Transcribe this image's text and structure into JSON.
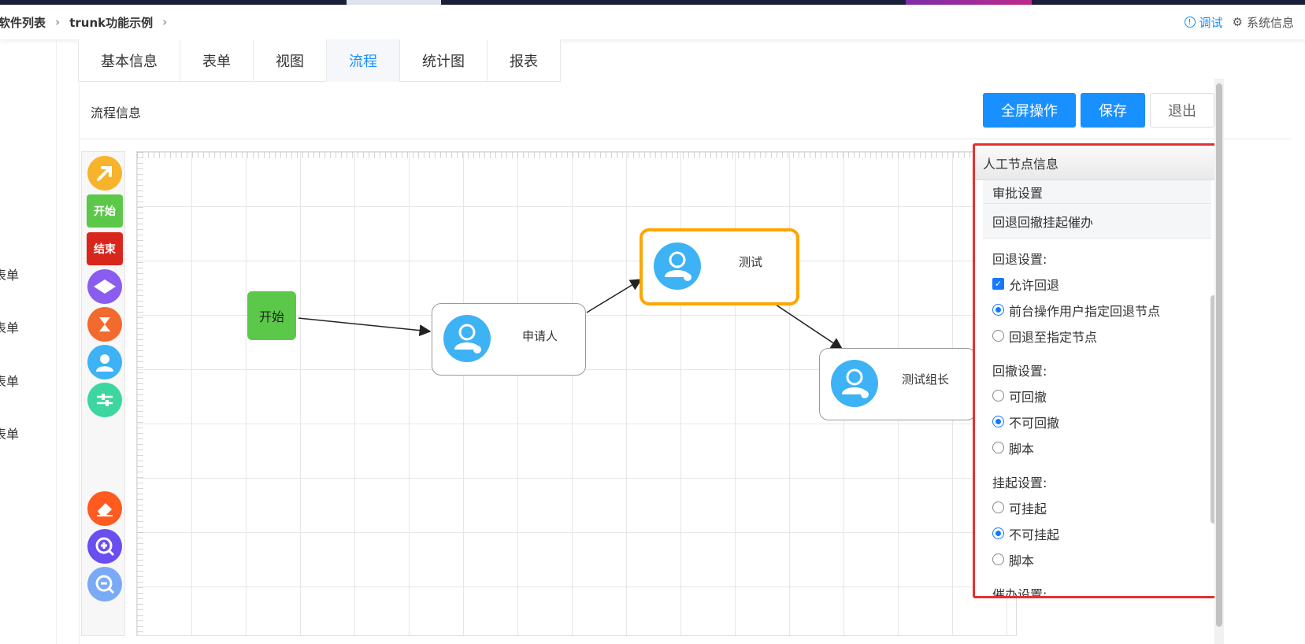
{
  "header": {
    "breadcrumb": [
      "软件列表",
      "trunk功能示例"
    ],
    "debug_label": "调试",
    "system_label": "系统信息"
  },
  "leftnav": {
    "items": [
      "表单",
      "表单",
      "表单",
      "表单"
    ]
  },
  "tabs": [
    {
      "label": "基本信息",
      "active": false
    },
    {
      "label": "表单",
      "active": false
    },
    {
      "label": "视图",
      "active": false
    },
    {
      "label": "流程",
      "active": true
    },
    {
      "label": "统计图",
      "active": false
    },
    {
      "label": "报表",
      "active": false
    }
  ],
  "panel": {
    "title": "流程信息",
    "buttons": {
      "fullscreen": "全屏操作",
      "save": "保存",
      "exit": "退出"
    }
  },
  "toolbar": {
    "tools": [
      {
        "name": "connector-arrow-tool",
        "color": "#f7b32b"
      },
      {
        "name": "start-node-tool",
        "label": "开始",
        "color": "#5cc84a"
      },
      {
        "name": "end-node-tool",
        "label": "结束",
        "color": "#d9261c"
      },
      {
        "name": "decision-node-tool",
        "color": "#8a5cf0"
      },
      {
        "name": "timer-node-tool",
        "color": "#f26a2e"
      },
      {
        "name": "manual-node-tool",
        "color": "#3db2f5"
      },
      {
        "name": "settings-tool",
        "color": "#3ed6a0"
      },
      {
        "name": "eraser-tool",
        "color": "#ff5a1f"
      },
      {
        "name": "zoom-in-tool",
        "color": "#6a4ef0"
      },
      {
        "name": "zoom-out-tool",
        "color": "#7aa9f5"
      }
    ]
  },
  "diagram": {
    "start_label": "开始",
    "nodes": {
      "applicant": "申请人",
      "test": "测试",
      "test_lead": "测试组长"
    },
    "selection_color": "#ffa500"
  },
  "right_panel": {
    "title": "人工节点信息",
    "sections": [
      "审批设置",
      "回退回撤挂起催办"
    ],
    "rollback": {
      "label": "回退设置:",
      "allow": "允许回退",
      "options": [
        "前台操作用户指定回退节点",
        "回退至指定节点"
      ],
      "selected": 0
    },
    "withdraw": {
      "label": "回撤设置:",
      "options": [
        "可回撤",
        "不可回撤",
        "脚本"
      ],
      "selected": 1
    },
    "suspend": {
      "label": "挂起设置:",
      "options": [
        "可挂起",
        "不可挂起",
        "脚本"
      ],
      "selected": 1
    },
    "urge_label": "催办设置:"
  },
  "colors": {
    "accent": "#1890ff",
    "highlight_border": "#e53030"
  }
}
